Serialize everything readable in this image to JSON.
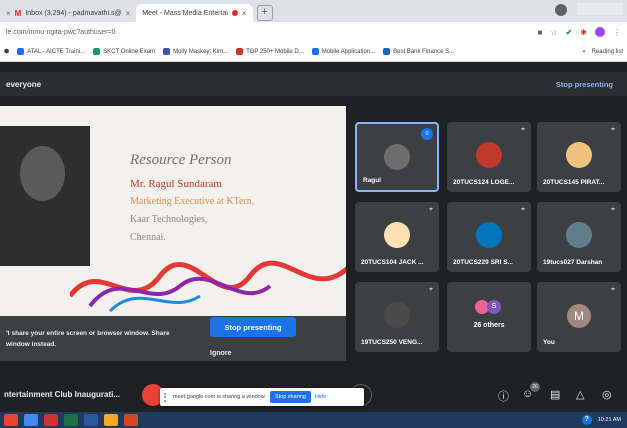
{
  "browser": {
    "tabs": [
      {
        "label": "Inbox (3,294) - padmavathi.s@",
        "active": false
      },
      {
        "label": "Meet - Mass Media Entertai",
        "active": true
      }
    ],
    "new_tab": "+",
    "url": "le.com/mmu-ngita-pwc?authuser=0",
    "bookmarks": [
      "ATAL - AICTE Traini...",
      "SKCT Online Exam",
      "Molly Maskey: Kim...",
      "TOP 250+ Mobile D...",
      "Mobile Application...",
      "Best Bank Finance S..."
    ],
    "reading_list": "Reading list",
    "more": "»"
  },
  "banner": {
    "label": "everyone",
    "stop": "Stop presenting"
  },
  "slide": {
    "title": "Resource Person",
    "name": "Mr. Ragul Sundaram",
    "role": "Marketing Executive at KTern,",
    "company": "Kaar Technologies,",
    "city": "Chennai."
  },
  "share_notice": {
    "line1": "'t share your entire screen or browser window. Share",
    "line2": "window instead.",
    "stop_button": "Stop presenting",
    "ignore_button": "Ignore"
  },
  "participants": [
    {
      "name": "Ragul",
      "avatar_color": "#6d6d6d"
    },
    {
      "name": "20TUCS124 LOGE...",
      "avatar_color": "#c0392b"
    },
    {
      "name": "20TUCS145 PIRAT...",
      "avatar_color": "#f1c27d"
    },
    {
      "name": "20TUCS104 JACK ...",
      "avatar_color": "#ffe0b2"
    },
    {
      "name": "20TUCS229 SRI S...",
      "avatar_color": "#0277bd"
    },
    {
      "name": "19tucs027 Darshan",
      "avatar_color": "#607d8b"
    },
    {
      "name": "19TUCS250 VENG...",
      "avatar_color": "#4a4a4a"
    },
    {
      "name": "26 others",
      "avatar_color": "#f06292"
    },
    {
      "name": "You",
      "avatar_color": "#a1887f",
      "letter": "M"
    }
  ],
  "others_initial": "S",
  "meeting": {
    "title": "ntertainment Club Inaugurati...",
    "participant_count": "26"
  },
  "sharing_bar": {
    "text": "meet.google.com is sharing a window.",
    "stop": "Stop sharing",
    "hide": "Hide"
  },
  "taskbar": {
    "time": "10:21 AM",
    "help": "?"
  }
}
